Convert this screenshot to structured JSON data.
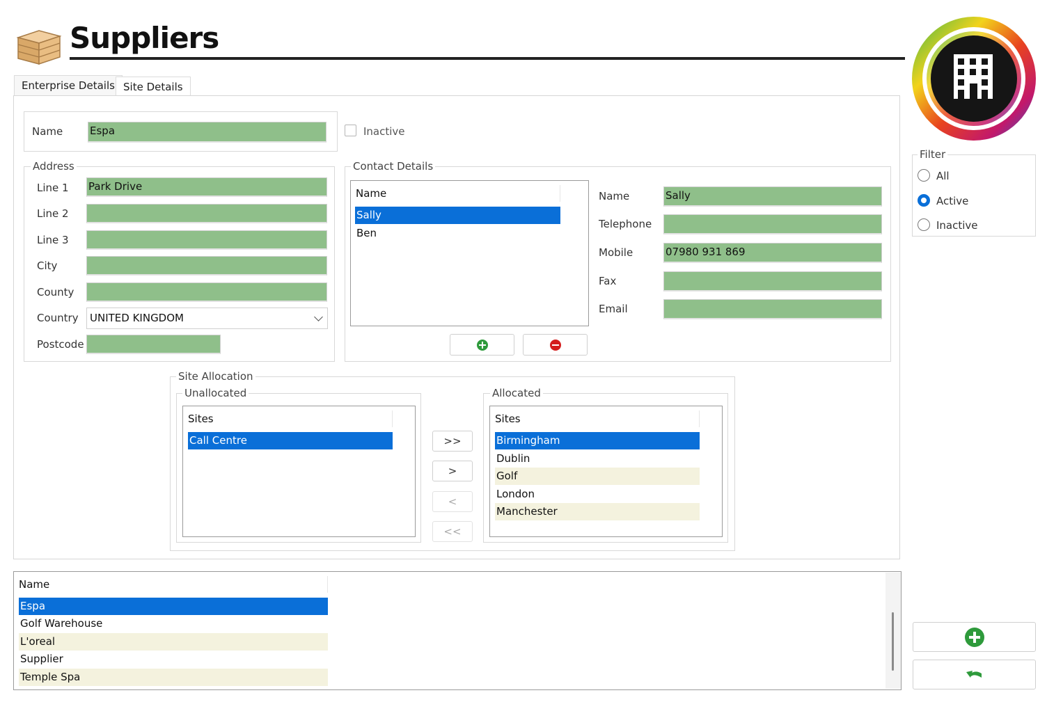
{
  "header": {
    "title": "Suppliers",
    "icon": "crate-icon",
    "logo": "building-logo"
  },
  "tabs": [
    {
      "label": "Enterprise Details",
      "active": true
    },
    {
      "label": "Site Details",
      "active": false
    }
  ],
  "enterprise": {
    "name_label": "Name",
    "name_value": "Espa",
    "inactive_label": "Inactive",
    "inactive_checked": false
  },
  "address": {
    "legend": "Address",
    "line1_label": "Line 1",
    "line1_value": "Park Drive",
    "line2_label": "Line 2",
    "line2_value": "",
    "line3_label": "Line 3",
    "line3_value": "",
    "city_label": "City",
    "city_value": "",
    "county_label": "County",
    "county_value": "",
    "country_label": "Country",
    "country_value": "UNITED KINGDOM",
    "postcode_label": "Postcode",
    "postcode_value": ""
  },
  "contact": {
    "legend": "Contact Details",
    "list_header": "Name",
    "contacts": [
      "Sally",
      "Ben"
    ],
    "selected": "Sally",
    "name_label": "Name",
    "name_value": "Sally",
    "telephone_label": "Telephone",
    "telephone_value": "",
    "mobile_label": "Mobile",
    "mobile_value": "07980 931 869",
    "fax_label": "Fax",
    "fax_value": "",
    "email_label": "Email",
    "email_value": "",
    "add_icon": "add-circle-icon",
    "remove_icon": "remove-circle-icon"
  },
  "site_allocation": {
    "legend": "Site Allocation",
    "unallocated": {
      "legend": "Unallocated",
      "header": "Sites",
      "items": [
        "Call Centre"
      ]
    },
    "allocated": {
      "legend": "Allocated",
      "header": "Sites",
      "items": [
        "Birmingham",
        "Dublin",
        "Golf",
        "London",
        "Manchester"
      ]
    },
    "buttons": {
      "all_right": ">>",
      "right": ">",
      "left": "<",
      "all_left": "<<"
    }
  },
  "filter": {
    "legend": "Filter",
    "options": [
      {
        "label": "All",
        "checked": false
      },
      {
        "label": "Active",
        "checked": true
      },
      {
        "label": "Inactive",
        "checked": false
      }
    ]
  },
  "suppliers_list": {
    "header": "Name",
    "items": [
      "Espa",
      "Golf Warehouse",
      "L'oreal",
      "Supplier",
      "Temple Spa"
    ],
    "selected": "Espa"
  },
  "actions": {
    "add_icon": "add-circle-icon",
    "undo_icon": "undo-arrow-icon"
  },
  "colors": {
    "field_green": "#8fbf8a",
    "selection_blue": "#0a6fd8",
    "alt_row": "#f4f2de"
  }
}
